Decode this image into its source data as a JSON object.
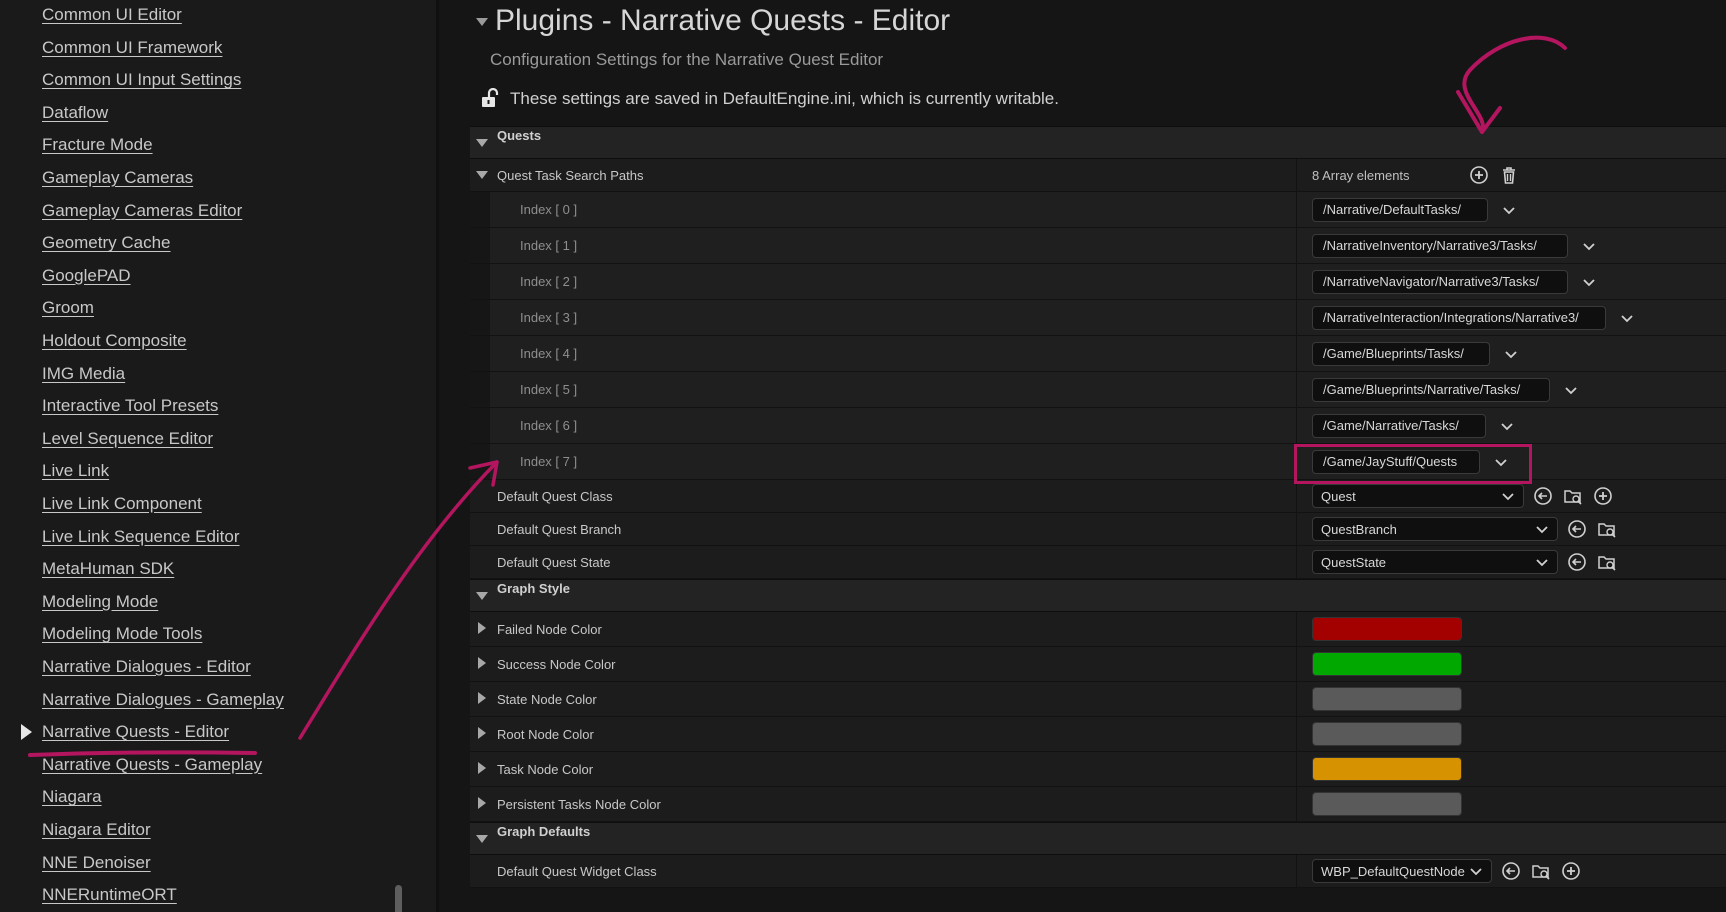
{
  "sidebar": {
    "items": [
      {
        "label": "Common UI Editor"
      },
      {
        "label": "Common UI Framework"
      },
      {
        "label": "Common UI Input Settings"
      },
      {
        "label": "Dataflow"
      },
      {
        "label": "Fracture Mode"
      },
      {
        "label": "Gameplay Cameras"
      },
      {
        "label": "Gameplay Cameras Editor"
      },
      {
        "label": "Geometry Cache"
      },
      {
        "label": "GooglePAD"
      },
      {
        "label": "Groom"
      },
      {
        "label": "Holdout Composite"
      },
      {
        "label": "IMG Media"
      },
      {
        "label": "Interactive Tool Presets"
      },
      {
        "label": "Level Sequence Editor"
      },
      {
        "label": "Live Link"
      },
      {
        "label": "Live Link Component"
      },
      {
        "label": "Live Link Sequence Editor"
      },
      {
        "label": "MetaHuman SDK"
      },
      {
        "label": "Modeling Mode"
      },
      {
        "label": "Modeling Mode Tools"
      },
      {
        "label": "Narrative Dialogues - Editor"
      },
      {
        "label": "Narrative Dialogues - Gameplay"
      },
      {
        "label": "Narrative Quests - Editor",
        "selected": true
      },
      {
        "label": "Narrative Quests - Gameplay"
      },
      {
        "label": "Niagara"
      },
      {
        "label": "Niagara Editor"
      },
      {
        "label": "NNE Denoiser"
      },
      {
        "label": "NNERuntimeORT"
      }
    ]
  },
  "header": {
    "title": "Plugins - Narrative Quests - Editor",
    "subtitle": "Configuration Settings for the Narrative Quest Editor",
    "save_note": "These settings are saved in DefaultEngine.ini, which is currently writable."
  },
  "quests": {
    "category": "Quests",
    "search_paths_label": "Quest Task Search Paths",
    "array_count": "8 Array elements",
    "elements": [
      {
        "index": "Index [ 0 ]",
        "value": "/Narrative/DefaultTasks/"
      },
      {
        "index": "Index [ 1 ]",
        "value": "/NarrativeInventory/Narrative3/Tasks/"
      },
      {
        "index": "Index [ 2 ]",
        "value": "/NarrativeNavigator/Narrative3/Tasks/"
      },
      {
        "index": "Index [ 3 ]",
        "value": "/NarrativeInteraction/Integrations/Narrative3/"
      },
      {
        "index": "Index [ 4 ]",
        "value": "/Game/Blueprints/Tasks/"
      },
      {
        "index": "Index [ 5 ]",
        "value": "/Game/Blueprints/Narrative/Tasks/"
      },
      {
        "index": "Index [ 6 ]",
        "value": "/Game/Narrative/Tasks/"
      },
      {
        "index": "Index [ 7 ]",
        "value": "/Game/JayStuff/Quests"
      }
    ],
    "default_class_label": "Default Quest Class",
    "default_class_value": "Quest",
    "default_branch_label": "Default Quest Branch",
    "default_branch_value": "QuestBranch",
    "default_state_label": "Default Quest State",
    "default_state_value": "QuestState"
  },
  "graph_style": {
    "category": "Graph Style",
    "colors": [
      {
        "label": "Failed Node Color",
        "color": "#a30000"
      },
      {
        "label": "Success Node Color",
        "color": "#00a800"
      },
      {
        "label": "State Node Color",
        "color": "#5a5a5a"
      },
      {
        "label": "Root Node Color",
        "color": "#5a5a5a"
      },
      {
        "label": "Task Node Color",
        "color": "#d69200"
      },
      {
        "label": "Persistent Tasks Node Color",
        "color": "#5a5a5a"
      }
    ]
  },
  "graph_defaults": {
    "category": "Graph Defaults",
    "widget_class_label": "Default Quest Widget Class",
    "widget_class_value": "WBP_DefaultQuestNode"
  },
  "colors": {
    "annotation": "#b3155f",
    "background": "#151515",
    "sidebar": "#1a1a1a"
  }
}
